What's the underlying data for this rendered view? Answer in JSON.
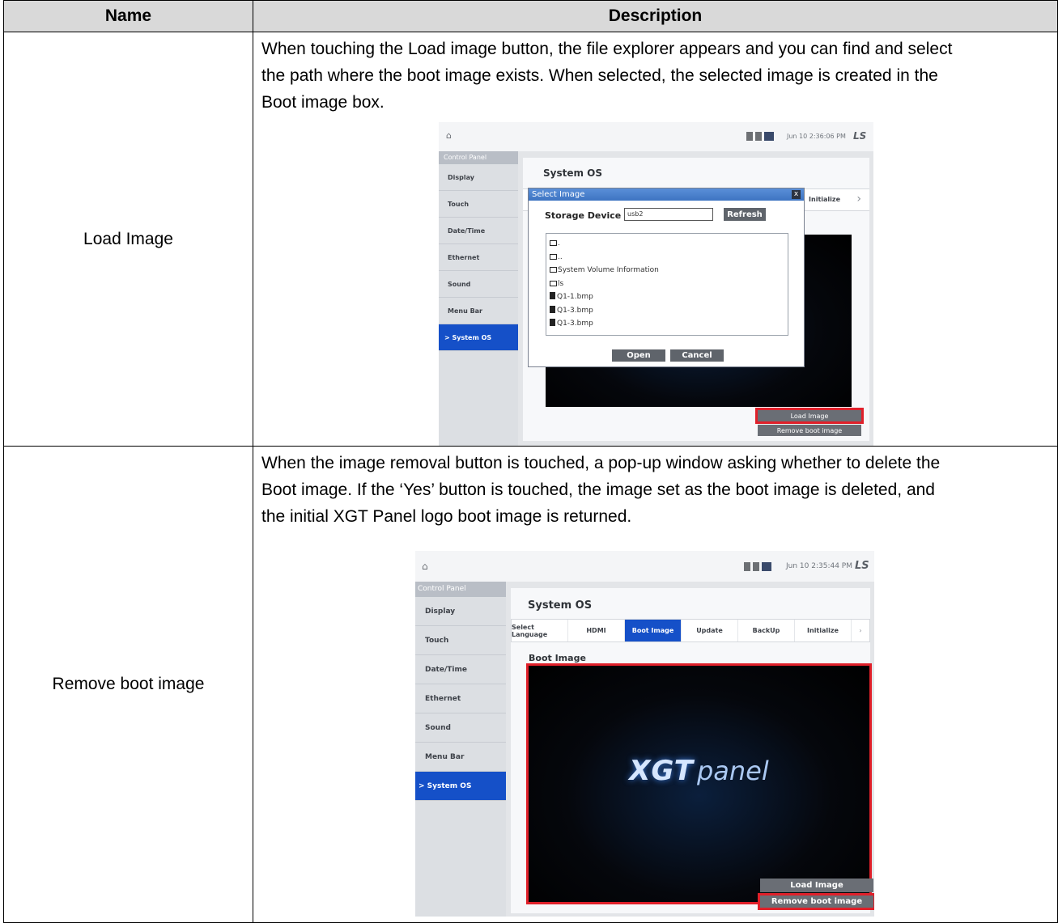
{
  "table": {
    "headers": {
      "name": "Name",
      "description": "Description"
    },
    "rows": [
      {
        "name": "Load Image",
        "description": [
          "When touching the Load image button, the file explorer appears and you can find and select",
          "the path where the boot image exists. When selected, the selected image is created in the",
          "Boot image box."
        ]
      },
      {
        "name": "Remove boot image",
        "description": [
          "When the image removal button is touched, a pop-up window asking whether to delete the",
          "Boot image. If the ‘Yes’ button is touched, the image set as the boot image is deleted, and",
          "the initial XGT Panel logo boot image is returned."
        ]
      }
    ]
  },
  "screens": {
    "load": {
      "clock": "Jun 10 2:36:06 PM",
      "brand": "LS",
      "sidebar_title": "Control Panel",
      "sidebar_items": [
        "Display",
        "Touch",
        "Date/Time",
        "Ethernet",
        "Sound",
        "Menu Bar",
        "System OS"
      ],
      "active_item": "> System OS",
      "panel_title": "System OS",
      "visible_tab": "Initialize",
      "dialog": {
        "title": "Select Image",
        "close": "x",
        "storage_label": "Storage Device",
        "storage_value": "usb2",
        "refresh": "Refresh",
        "entries": [
          {
            "kind": "folder",
            "name": "."
          },
          {
            "kind": "folder",
            "name": ".."
          },
          {
            "kind": "folder",
            "name": "System Volume Information"
          },
          {
            "kind": "folder",
            "name": "ls"
          },
          {
            "kind": "file",
            "name": "Q1-1.bmp"
          },
          {
            "kind": "file",
            "name": "Q1-3.bmp"
          },
          {
            "kind": "file",
            "name": "Q1-3.bmp"
          }
        ],
        "open": "Open",
        "cancel": "Cancel"
      },
      "load_button": "Load Image",
      "remove_button": "Remove boot image"
    },
    "remove": {
      "clock": "Jun 10 2:35:44 PM",
      "brand": "LS",
      "sidebar_title": "Control Panel",
      "sidebar_items": [
        "Display",
        "Touch",
        "Date/Time",
        "Ethernet",
        "Sound",
        "Menu Bar"
      ],
      "active_item": "> System OS",
      "panel_title": "System OS",
      "tabs": [
        "Select Language",
        "HDMI",
        "Boot Image",
        "Update",
        "BackUp",
        "Initialize"
      ],
      "active_tab": "Boot Image",
      "boot_image_label": "Boot Image",
      "logo": {
        "xgt": "XGT",
        "panel": "panel"
      },
      "load_button": "Load Image",
      "remove_button": "Remove boot image"
    }
  },
  "colors": {
    "accent": "#1550c8",
    "highlight": "#e0202a",
    "header_bg": "#d9d9d9"
  }
}
